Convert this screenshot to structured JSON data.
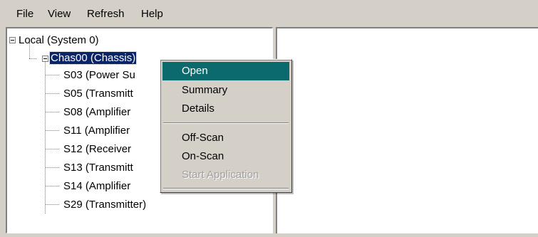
{
  "menubar": {
    "file": "File",
    "view": "View",
    "refresh": "Refresh",
    "help": "Help"
  },
  "tree": {
    "root": "Local (System 0)",
    "chassis": "Chas00 (Chassis)",
    "children": [
      "S03 (Power Su",
      "S05 (Transmitt",
      "S08 (Amplifier",
      "S11 (Amplifier",
      "S12 (Receiver",
      "S13 (Transmitt",
      "S14 (Amplifier",
      "S29 (Transmitter)"
    ]
  },
  "context_menu": {
    "open": "Open",
    "summary": "Summary",
    "details": "Details",
    "off_scan": "Off-Scan",
    "on_scan": "On-Scan",
    "start_application": "Start Application"
  },
  "colors": {
    "selection": "#0a246a",
    "menu_highlight": "#0a6a6d",
    "face": "#d4d0c8"
  }
}
